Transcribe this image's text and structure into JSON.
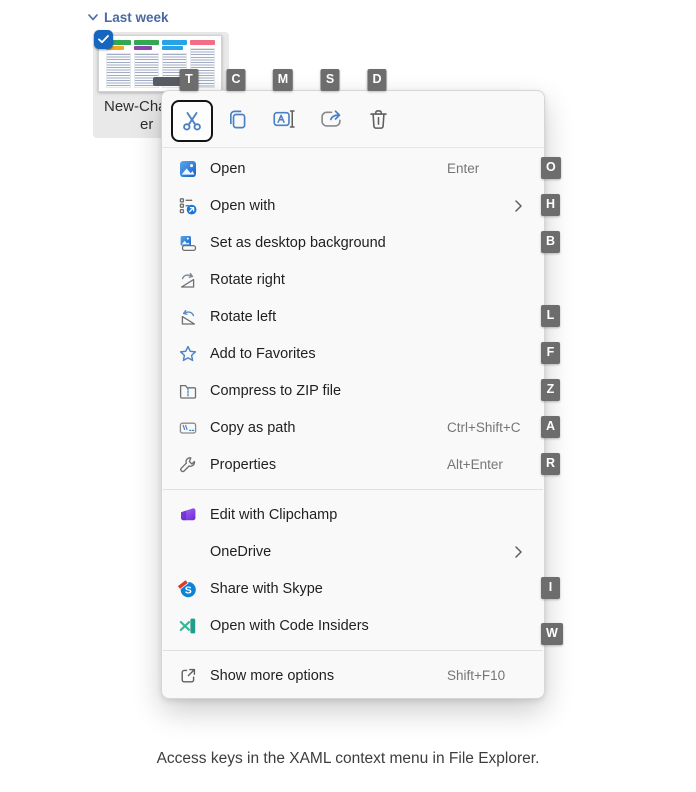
{
  "page": {
    "caption": "Access keys in the XAML context menu in File Explorer."
  },
  "group_header": {
    "label": "Last week",
    "icon": "chevron-down-icon"
  },
  "file_tile": {
    "name_line1": "New-Cha",
    "name_line2": "er",
    "selected": true,
    "thumbnail_header_colors": [
      "#33a852",
      "#f5a623",
      "#8e44ad",
      "#29a3e8",
      "#f26d85"
    ]
  },
  "command_bar": {
    "buttons": [
      {
        "id": "cut",
        "icon": "scissors-icon",
        "access_key": "T",
        "focused": true
      },
      {
        "id": "copy",
        "icon": "copy-icon",
        "access_key": "C",
        "focused": false
      },
      {
        "id": "rename",
        "icon": "rename-icon",
        "access_key": "M",
        "focused": false
      },
      {
        "id": "share",
        "icon": "share-icon",
        "access_key": "S",
        "focused": false
      },
      {
        "id": "delete",
        "icon": "delete-icon",
        "access_key": "D",
        "focused": false
      }
    ]
  },
  "context_menu": {
    "items": [
      {
        "id": "open",
        "label": "Open",
        "icon": "photo-icon",
        "shortcut": "Enter",
        "access_key": "O",
        "submenu": false
      },
      {
        "id": "open-with",
        "label": "Open with",
        "icon": "open-with-icon",
        "shortcut": "",
        "access_key": "H",
        "submenu": true
      },
      {
        "id": "set-desktop-background",
        "label": "Set as desktop background",
        "icon": "desktop-background-icon",
        "shortcut": "",
        "access_key": "B",
        "submenu": false
      },
      {
        "id": "rotate-right",
        "label": "Rotate right",
        "icon": "rotate-right-icon",
        "shortcut": "",
        "access_key": "",
        "submenu": false
      },
      {
        "id": "rotate-left",
        "label": "Rotate left",
        "icon": "rotate-left-icon",
        "shortcut": "",
        "access_key": "L",
        "submenu": false
      },
      {
        "id": "add-to-favorites",
        "label": "Add to Favorites",
        "icon": "star-icon",
        "shortcut": "",
        "access_key": "F",
        "submenu": false
      },
      {
        "id": "compress-zip",
        "label": "Compress to ZIP file",
        "icon": "zip-folder-icon",
        "shortcut": "",
        "access_key": "Z",
        "submenu": false
      },
      {
        "id": "copy-as-path",
        "label": "Copy as path",
        "icon": "copy-path-icon",
        "shortcut": "Ctrl+Shift+C",
        "access_key": "A",
        "submenu": false
      },
      {
        "id": "properties",
        "label": "Properties",
        "icon": "wrench-icon",
        "shortcut": "Alt+Enter",
        "access_key": "R",
        "submenu": false
      },
      {
        "type": "separator"
      },
      {
        "id": "edit-clipchamp",
        "label": "Edit with Clipchamp",
        "icon": "clipchamp-icon",
        "shortcut": "",
        "access_key": "",
        "submenu": false
      },
      {
        "id": "onedrive",
        "label": "OneDrive",
        "icon": "",
        "shortcut": "",
        "access_key": "",
        "submenu": true
      },
      {
        "id": "share-skype",
        "label": "Share with Skype",
        "icon": "skype-icon",
        "shortcut": "",
        "access_key": "I",
        "submenu": false
      },
      {
        "id": "open-code-insiders",
        "label": "Open with Code Insiders",
        "icon": "code-insiders-icon",
        "shortcut": "",
        "access_key": "W",
        "submenu": false
      },
      {
        "type": "separator"
      },
      {
        "id": "show-more-options",
        "label": "Show more options",
        "icon": "show-more-icon",
        "shortcut": "Shift+F10",
        "access_key": "",
        "submenu": false
      }
    ]
  },
  "colors": {
    "menu_background": "#f9f9f9",
    "badge_background": "#6d6d6d",
    "accent_blue": "#4a80c4",
    "selection_background": "#e9e9e9",
    "group_header_text": "#4a69a0"
  }
}
